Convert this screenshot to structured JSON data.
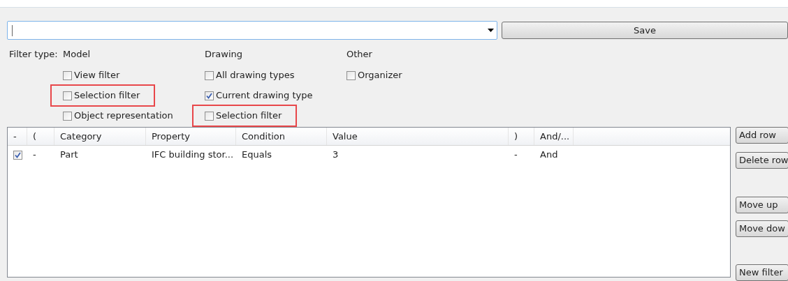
{
  "combo": {
    "value": "|"
  },
  "save_button": "Save",
  "filter_type": {
    "label": "Filter type:",
    "groups": [
      {
        "title": "Model",
        "options": [
          {
            "label": "View filter",
            "checked": false,
            "highlighted": false
          },
          {
            "label": "Selection filter",
            "checked": false,
            "highlighted": true
          },
          {
            "label": "Object representation",
            "checked": false,
            "highlighted": false
          }
        ]
      },
      {
        "title": "Drawing",
        "options": [
          {
            "label": "All drawing types",
            "checked": false,
            "highlighted": false
          },
          {
            "label": "Current drawing type",
            "checked": true,
            "highlighted": false
          },
          {
            "label": "Selection filter",
            "checked": false,
            "highlighted": true
          }
        ]
      },
      {
        "title": "Other",
        "options": [
          {
            "label": "Organizer",
            "checked": false,
            "highlighted": false
          }
        ]
      }
    ]
  },
  "table": {
    "columns": [
      "-",
      "(",
      "Category",
      "Property",
      "Condition",
      "Value",
      ")",
      "And/..."
    ],
    "rows": [
      {
        "cells": [
          {
            "kind": "checkbox",
            "checked": true
          },
          {
            "kind": "text",
            "text": "-"
          },
          {
            "kind": "text",
            "text": "Part"
          },
          {
            "kind": "text",
            "text": "IFC building stor..."
          },
          {
            "kind": "text",
            "text": "Equals"
          },
          {
            "kind": "text",
            "text": "3"
          },
          {
            "kind": "text",
            "text": "-"
          },
          {
            "kind": "text",
            "text": "And"
          }
        ]
      }
    ]
  },
  "side_buttons": [
    "Add row",
    "Delete row",
    "Move up",
    "Move dow",
    "New filter"
  ]
}
